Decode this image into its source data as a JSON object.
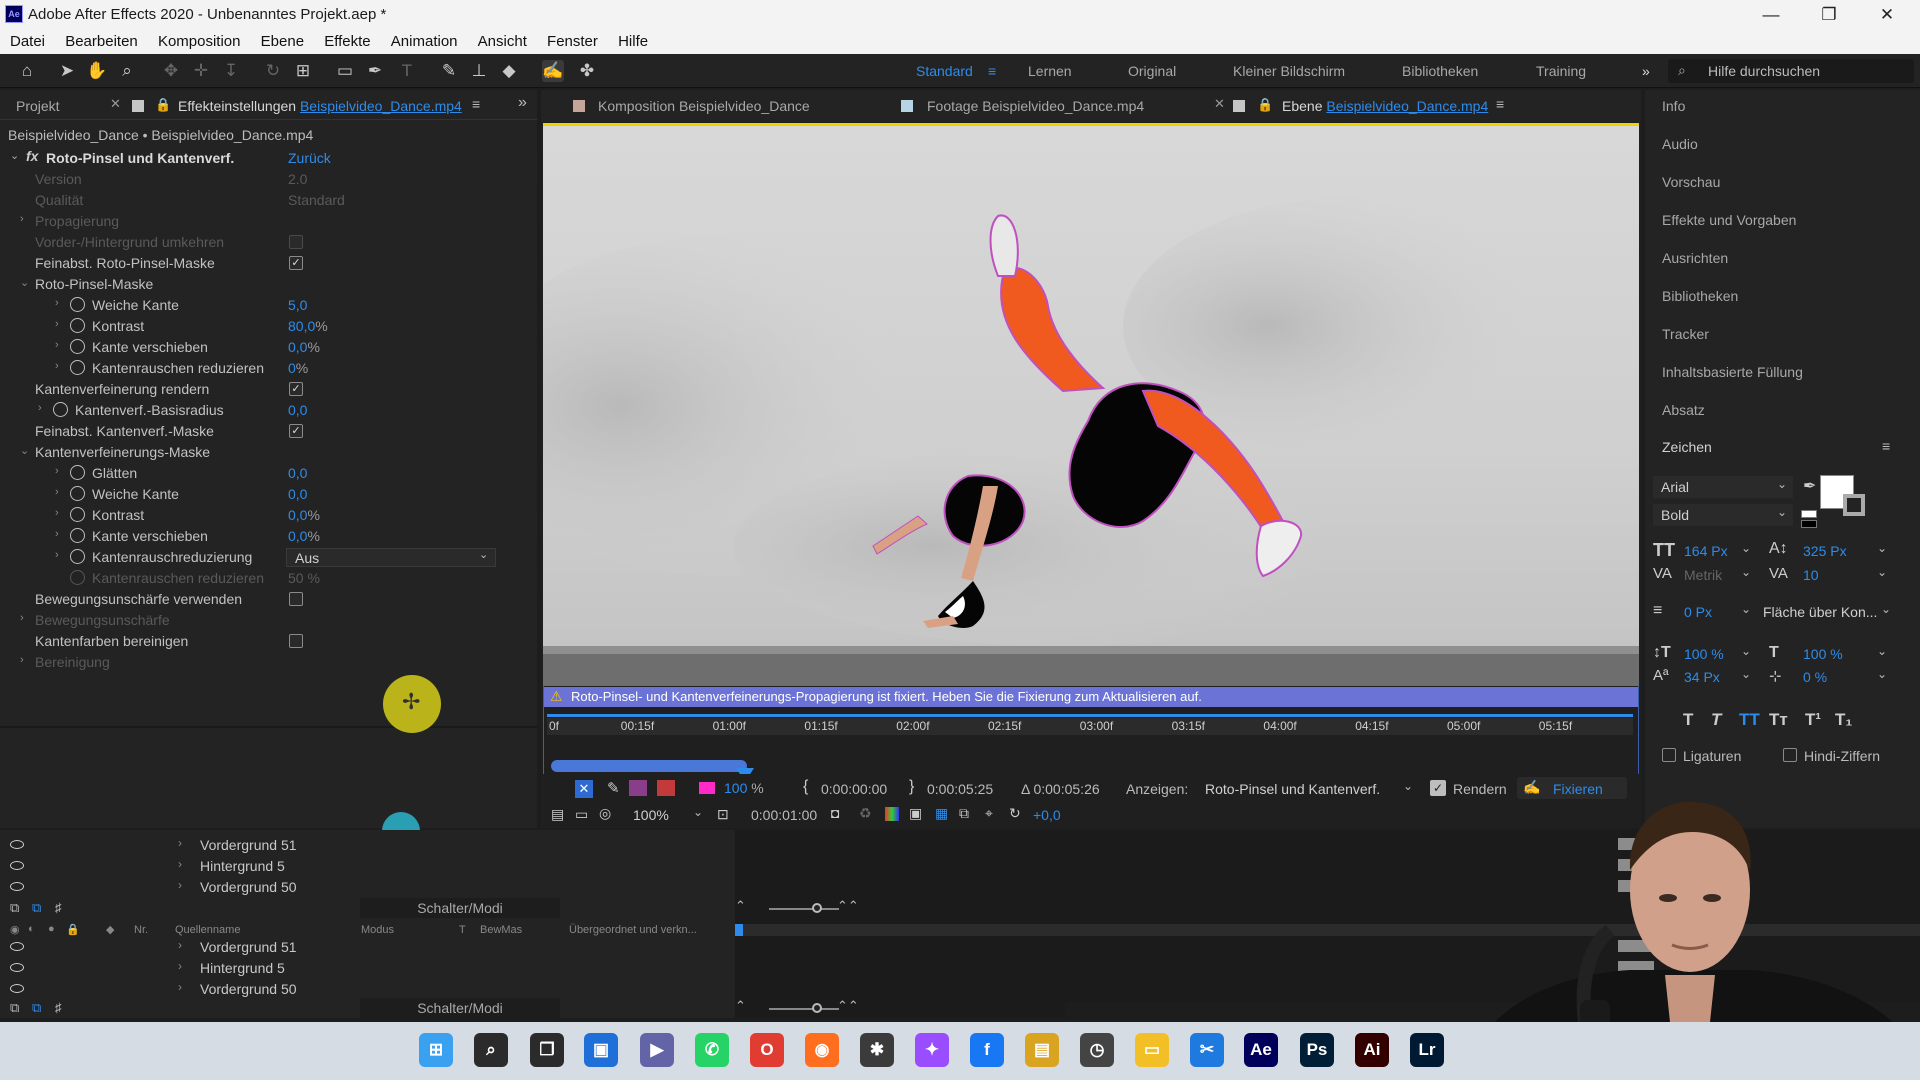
{
  "window": {
    "title": "Adobe After Effects 2020 - Unbenanntes Projekt.aep *",
    "app_icon": "Ae",
    "minimize": "—",
    "maximize": "❐",
    "close": "✕"
  },
  "menu": [
    "Datei",
    "Bearbeiten",
    "Komposition",
    "Ebene",
    "Effekte",
    "Animation",
    "Ansicht",
    "Fenster",
    "Hilfe"
  ],
  "workspaces": {
    "items": [
      "Standard",
      "Lernen",
      "Original",
      "Kleiner Bildschirm",
      "Bibliotheken",
      "Training"
    ],
    "active": "Standard",
    "more": "»"
  },
  "search": {
    "placeholder": "Hilfe durchsuchen"
  },
  "left_panel": {
    "tab_project": "Projekt",
    "tab_effects_prefix": "Effekteinstellungen",
    "tab_effects_file": "Beispielvideo_Dance.mp4",
    "breadcrumb": "Beispielvideo_Dance • Beispielvideo_Dance.mp4",
    "effect_name": "Roto-Pinsel und Kantenverf.",
    "reset": "Zurück",
    "rows": [
      {
        "label": "Version",
        "value": "2.0",
        "disabled": true
      },
      {
        "label": "Qualität",
        "value": "Standard",
        "disabled": true
      },
      {
        "label": "Propagierung",
        "disabled": true
      },
      {
        "label": "Vorder-/Hintergrund umkehren",
        "disabled": true
      },
      {
        "label": "Feinabst. Roto-Pinsel-Maske",
        "checked": true
      },
      {
        "label": "Roto-Pinsel-Maske"
      },
      {
        "label": "Weiche Kante",
        "value": "5,0"
      },
      {
        "label": "Kontrast",
        "value": "80,0",
        "unit": "%"
      },
      {
        "label": "Kante verschieben",
        "value": "0,0",
        "unit": "%"
      },
      {
        "label": "Kantenrauschen reduzieren",
        "value": "0",
        "unit": "%"
      },
      {
        "label": "Kantenverfeinerung rendern",
        "checked": true
      },
      {
        "label": "Kantenverf.-Basisradius",
        "value": "0,0"
      },
      {
        "label": "Feinabst. Kantenverf.-Maske",
        "checked": true
      },
      {
        "label": "Kantenverfeinerungs-Maske"
      },
      {
        "label": "Glätten",
        "value": "0,0"
      },
      {
        "label": "Weiche Kante",
        "value": "0,0"
      },
      {
        "label": "Kontrast",
        "value": "0,0",
        "unit": "%"
      },
      {
        "label": "Kante verschieben",
        "value": "0,0",
        "unit": "%"
      },
      {
        "label": "Kantenrauschreduzierung",
        "value": "Aus"
      },
      {
        "label": "Kantenrauschen reduzieren",
        "value": "50 %",
        "disabled": true
      },
      {
        "label": "Bewegungsunschärfe verwenden",
        "checked": false
      },
      {
        "label": "Bewegungsunschärfe",
        "disabled": true
      },
      {
        "label": "Kantenfarben bereinigen",
        "checked": false
      },
      {
        "label": "Bereinigung",
        "disabled": true
      }
    ]
  },
  "viewer": {
    "tab_comp_prefix": "Komposition",
    "tab_comp_name": "Beispielvideo_Dance",
    "tab_footage_prefix": "Footage",
    "tab_footage_name": "Beispielvideo_Dance.mp4",
    "tab_layer_prefix": "Ebene",
    "tab_layer_name": "Beispielvideo_Dance.mp4",
    "warning": "Roto-Pinsel- und Kantenverfeinerungs-Propagierung ist fixiert. Heben Sie die Fixierung zum Aktualisieren auf.",
    "ruler": [
      "0f",
      "00:15f",
      "01:00f",
      "01:15f",
      "02:00f",
      "02:15f",
      "03:00f",
      "03:15f",
      "04:00f",
      "04:15f",
      "05:00f",
      "05:15f"
    ],
    "opacity": "100",
    "opacity_unit": "%",
    "in_time": "0:00:00:00",
    "out_time": "0:00:05:25",
    "duration": "Δ 0:00:05:26",
    "show_label": "Anzeigen:",
    "show_value": "Roto-Pinsel und Kantenverf.",
    "render_label": "Rendern",
    "freeze_label": "Fixieren",
    "zoom": "100%",
    "current_time": "0:00:01:00",
    "exposure": "+0,0"
  },
  "right_panel": {
    "items": [
      "Info",
      "Audio",
      "Vorschau",
      "Effekte und Vorgaben",
      "Ausrichten",
      "Bibliotheken",
      "Tracker",
      "Inhaltsbasierte Füllung",
      "Absatz"
    ],
    "character_title": "Zeichen",
    "font": "Arial",
    "style": "Bold",
    "size": "164 Px",
    "leading": "325 Px",
    "kerning": "Metrik",
    "tracking": "10",
    "stroke_width": "0 Px",
    "stroke_type": "Fläche über Kon...",
    "vscale": "100 %",
    "hscale": "100 %",
    "baseline": "34 Px",
    "tsume": "0 %",
    "format_buttons": [
      "T",
      "T",
      "TT",
      "Tт",
      "T¹",
      "T₁"
    ],
    "ligatures": "Ligaturen",
    "hindi": "Hindi-Ziffern"
  },
  "timeline": {
    "top_layers": [
      "Vordergrund 51",
      "Hintergrund 5",
      "Vordergrund 50"
    ],
    "switches": "Schalter/Modi",
    "col_nr": "Nr.",
    "col_source": "Quellenname",
    "col_mode": "Modus",
    "col_t": "T",
    "col_trkmat": "BewMas",
    "col_parent": "Übergeordnet und verkn...",
    "bottom_layers": [
      "Vordergrund 51",
      "Hintergrund 5",
      "Vordergrund 50"
    ],
    "switches2": "Schalter/Modi"
  },
  "taskbar": [
    {
      "name": "windows-start-icon",
      "label": "⊞",
      "color": "#3aa0f0"
    },
    {
      "name": "search-icon",
      "label": "⌕",
      "color": "#2b2b2b"
    },
    {
      "name": "task-view-icon",
      "label": "❐",
      "color": "#2b2b2b"
    },
    {
      "name": "widgets-icon",
      "label": "▣",
      "color": "#1f6fd8"
    },
    {
      "name": "teams-chat-icon",
      "label": "▶",
      "color": "#6264a7"
    },
    {
      "name": "whatsapp-icon",
      "label": "✆",
      "color": "#25d366"
    },
    {
      "name": "office-icon",
      "label": "O",
      "color": "#e03c31"
    },
    {
      "name": "firefox-icon",
      "label": "◉",
      "color": "#ff6d1f"
    },
    {
      "name": "app-figure-icon",
      "label": "✱",
      "color": "#3b3b3b"
    },
    {
      "name": "messenger-icon",
      "label": "✦",
      "color": "#9a4dff"
    },
    {
      "name": "facebook-icon",
      "label": "f",
      "color": "#1877f2"
    },
    {
      "name": "photos-icon",
      "label": "▤",
      "color": "#d9a520"
    },
    {
      "name": "clock-app-icon",
      "label": "◷",
      "color": "#444"
    },
    {
      "name": "file-explorer-icon",
      "label": "▭",
      "color": "#f2c026"
    },
    {
      "name": "capcut-icon",
      "label": "✂",
      "color": "#1f7ae0"
    },
    {
      "name": "after-effects-icon",
      "label": "Ae",
      "color": "#00005b"
    },
    {
      "name": "photoshop-icon",
      "label": "Ps",
      "color": "#001e36"
    },
    {
      "name": "illustrator-icon",
      "label": "Ai",
      "color": "#330000"
    },
    {
      "name": "lightroom-icon",
      "label": "Lr",
      "color": "#001a33"
    }
  ]
}
